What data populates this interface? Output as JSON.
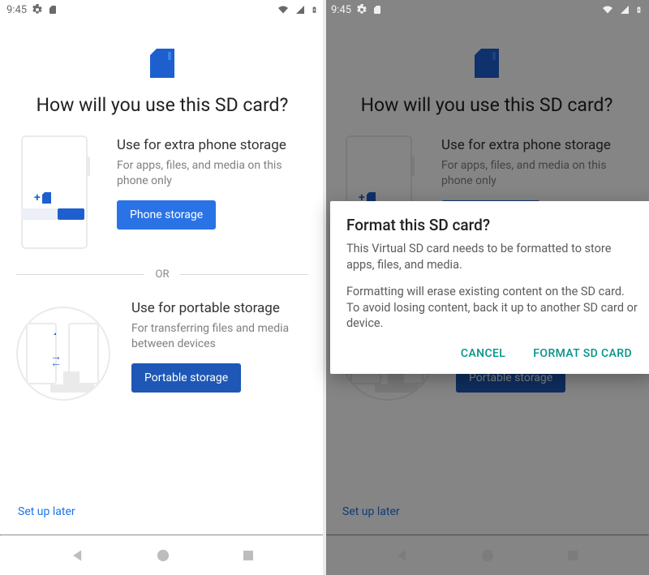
{
  "status": {
    "time": "9:45"
  },
  "screen": {
    "headline": "How will you use this SD card?",
    "or_label": "OR",
    "option_phone": {
      "title": "Use for extra phone storage",
      "desc": "For apps, files, and media on this phone only",
      "button": "Phone storage"
    },
    "option_portable": {
      "title": "Use for portable storage",
      "desc": "For transferring files and media between devices",
      "button": "Portable storage"
    },
    "setup_later": "Set up later"
  },
  "dialog": {
    "title": "Format this SD card?",
    "body1": "This Virtual SD card needs to be formatted to store apps, files, and media.",
    "body2": "Formatting will erase existing content on the SD card. To avoid losing content, back it up to another SD card or device.",
    "cancel": "CANCEL",
    "confirm": "FORMAT SD CARD"
  },
  "colors": {
    "accent": "#1a73e8",
    "button": "#2a73e6",
    "dialog_action": "#009688"
  }
}
